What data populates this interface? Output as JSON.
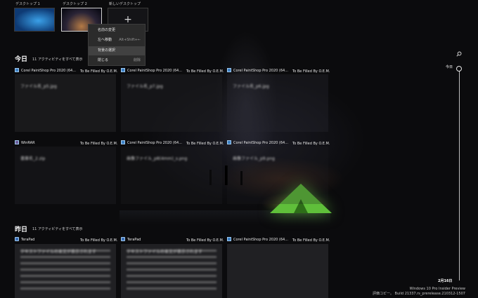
{
  "desktops": [
    {
      "label": "デスクトップ 1",
      "thumb": "windows-wallpaper"
    },
    {
      "label": "デスクトップ 2",
      "thumb": "milkyway-wallpaper",
      "selected": true
    },
    {
      "label": "新しいデスクトップ",
      "thumb": "plus-icon"
    }
  ],
  "new_desktop_symbol": "+",
  "context_menu": {
    "items": [
      {
        "label": "名前の変更",
        "shortcut": ""
      },
      {
        "label": "左へ移動",
        "shortcut": "Alt+Shift+←"
      },
      {
        "label": "背景の選択",
        "shortcut": "",
        "highlighted": true
      },
      {
        "label": "閉じる",
        "shortcut": "削除"
      }
    ]
  },
  "sections": {
    "today": {
      "title": "今日",
      "see_all": "11 アクティビティをすべて表示"
    },
    "yesterday": {
      "title": "昨日",
      "see_all": "11 アクティビティをすべて表示"
    }
  },
  "today_cards": [
    {
      "app": "Corel PaintShop Pro 2020 (64...",
      "subtitle": "To Be Filled By O.E.M.",
      "content": "ファイル名_p5.jpg"
    },
    {
      "app": "Corel PaintShop Pro 2020 (64...",
      "subtitle": "To Be Filled By O.E.M.",
      "content": "ファイル名_p7.jpg"
    },
    {
      "app": "Corel PaintShop Pro 2020 (64...",
      "subtitle": "To Be Filled By O.E.M.",
      "content": "ファイル名_p6.jpg"
    },
    {
      "app": "WinRAR",
      "subtitle": "To Be Filled By O.E.M.",
      "content": "書庫名_2.zip"
    },
    {
      "app": "Corel PaintShop Pro 2020 (64...",
      "subtitle": "To Be Filled By O.E.M.",
      "content": "画像ファイル_p8(4mm)_s.png"
    },
    {
      "app": "Corel PaintShop Pro 2020 (64...",
      "subtitle": "To Be Filled By O.E.M.",
      "content": "画像ファイル_p9.png"
    }
  ],
  "yesterday_cards": [
    {
      "app": "TeraPad",
      "subtitle": "To Be Filled By O.E.M.",
      "content": "テキストファイルの本文が表示されます"
    },
    {
      "app": "TeraPad",
      "subtitle": "To Be Filled By O.E.M.",
      "content": "テキストファイルの本文が表示されます"
    },
    {
      "app": "Corel PaintShop Pro 2020 (64...",
      "subtitle": "To Be Filled By O.E.M.",
      "content": ""
    }
  ],
  "timeline": {
    "today_label": "今日",
    "date_label": "2月16日"
  },
  "watermark": {
    "line1": "Windows 10 Pro Insider Preview",
    "line2": "評価コピー。 Build 21337.rs_prerelease.210312-1507"
  }
}
